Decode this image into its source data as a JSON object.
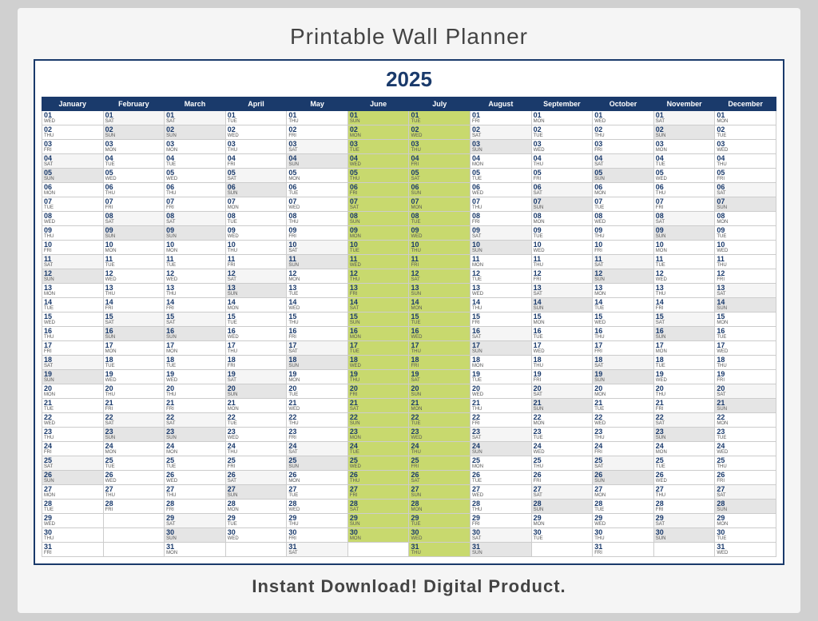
{
  "title": "Printable Wall Planner",
  "year": "2025",
  "footer": "Instant Download!  Digital Product.",
  "months": [
    {
      "name": "January",
      "abbr": "Jan"
    },
    {
      "name": "February",
      "abbr": "Feb"
    },
    {
      "name": "March",
      "abbr": "Mar"
    },
    {
      "name": "April",
      "abbr": "Apr"
    },
    {
      "name": "May",
      "abbr": "May"
    },
    {
      "name": "June",
      "abbr": "Jun"
    },
    {
      "name": "July",
      "abbr": "Jul"
    },
    {
      "name": "August",
      "abbr": "Aug"
    },
    {
      "name": "September",
      "abbr": "Sep"
    },
    {
      "name": "October",
      "abbr": "Oct"
    },
    {
      "name": "November",
      "abbr": "Nov"
    },
    {
      "name": "December",
      "abbr": "Dec"
    }
  ],
  "days_2025": {
    "Jan": [
      "WED",
      "THU",
      "FRI",
      "SAT",
      "SUN",
      "MON",
      "TUE",
      "WED",
      "THU",
      "FRI",
      "SAT",
      "SUN",
      "MON",
      "TUE",
      "WED",
      "THU",
      "FRI",
      "SAT",
      "SUN",
      "MON",
      "TUE",
      "WED",
      "THU",
      "FRI",
      "SAT",
      "SUN",
      "MON",
      "TUE",
      "WED",
      "THU",
      "FRI"
    ],
    "Feb": [
      "SAT",
      "SUN",
      "MON",
      "TUE",
      "WED",
      "THU",
      "FRI",
      "SAT",
      "SUN",
      "MON",
      "TUE",
      "WED",
      "THU",
      "FRI",
      "SAT",
      "SUN",
      "MON",
      "TUE",
      "WED",
      "THU",
      "FRI",
      "SAT",
      "SUN",
      "MON",
      "TUE",
      "WED",
      "THU",
      "FRI",
      "",
      "",
      ""
    ],
    "Mar": [
      "SAT",
      "SUN",
      "MON",
      "TUE",
      "WED",
      "THU",
      "FRI",
      "SAT",
      "SUN",
      "MON",
      "TUE",
      "WED",
      "THU",
      "FRI",
      "SAT",
      "SUN",
      "MON",
      "TUE",
      "WED",
      "THU",
      "FRI",
      "SAT",
      "SUN",
      "MON",
      "TUE",
      "WED",
      "THU",
      "FRI",
      "SAT",
      "SUN",
      "MON"
    ],
    "Apr": [
      "TUE",
      "WED",
      "THU",
      "FRI",
      "SAT",
      "SUN",
      "MON",
      "TUE",
      "WED",
      "THU",
      "FRI",
      "SAT",
      "SUN",
      "MON",
      "TUE",
      "WED",
      "THU",
      "FRI",
      "SAT",
      "SUN",
      "MON",
      "TUE",
      "WED",
      "THU",
      "FRI",
      "SAT",
      "SUN",
      "MON",
      "TUE",
      "WED",
      ""
    ],
    "May": [
      "THU",
      "FRI",
      "SAT",
      "SUN",
      "MON",
      "TUE",
      "WED",
      "THU",
      "FRI",
      "SAT",
      "SUN",
      "MON",
      "TUE",
      "WED",
      "THU",
      "FRI",
      "SAT",
      "SUN",
      "MON",
      "TUE",
      "WED",
      "THU",
      "FRI",
      "SAT",
      "SUN",
      "MON",
      "TUE",
      "WED",
      "THU",
      "FRI",
      "SAT"
    ],
    "Jun": [
      "SUN",
      "MON",
      "TUE",
      "WED",
      "THU",
      "FRI",
      "SAT",
      "SUN",
      "MON",
      "TUE",
      "WED",
      "THU",
      "FRI",
      "SAT",
      "SUN",
      "MON",
      "TUE",
      "WED",
      "THU",
      "FRI",
      "SAT",
      "SUN",
      "MON",
      "TUE",
      "WED",
      "THU",
      "FRI",
      "SAT",
      "SUN",
      "MON",
      ""
    ],
    "Jul": [
      "TUE",
      "WED",
      "THU",
      "FRI",
      "SAT",
      "SUN",
      "MON",
      "TUE",
      "WED",
      "THU",
      "FRI",
      "SAT",
      "SUN",
      "MON",
      "TUE",
      "WED",
      "THU",
      "FRI",
      "SAT",
      "SUN",
      "MON",
      "TUE",
      "WED",
      "THU",
      "FRI",
      "SAT",
      "SUN",
      "MON",
      "TUE",
      "WED",
      "THU"
    ],
    "Aug": [
      "FRI",
      "SAT",
      "SUN",
      "MON",
      "TUE",
      "WED",
      "THU",
      "FRI",
      "SAT",
      "SUN",
      "MON",
      "TUE",
      "WED",
      "THU",
      "FRI",
      "SAT",
      "SUN",
      "MON",
      "TUE",
      "WED",
      "THU",
      "FRI",
      "SAT",
      "SUN",
      "MON",
      "TUE",
      "WED",
      "THU",
      "FRI",
      "SAT",
      "SUN"
    ],
    "Sep": [
      "MON",
      "TUE",
      "WED",
      "THU",
      "FRI",
      "SAT",
      "SUN",
      "MON",
      "TUE",
      "WED",
      "THU",
      "FRI",
      "SAT",
      "SUN",
      "MON",
      "TUE",
      "WED",
      "THU",
      "FRI",
      "SAT",
      "SUN",
      "MON",
      "TUE",
      "WED",
      "THU",
      "FRI",
      "SAT",
      "SUN",
      "MON",
      "TUE",
      ""
    ],
    "Oct": [
      "WED",
      "THU",
      "FRI",
      "SAT",
      "SUN",
      "MON",
      "TUE",
      "WED",
      "THU",
      "FRI",
      "SAT",
      "SUN",
      "MON",
      "TUE",
      "WED",
      "THU",
      "FRI",
      "SAT",
      "SUN",
      "MON",
      "TUE",
      "WED",
      "THU",
      "FRI",
      "SAT",
      "SUN",
      "MON",
      "TUE",
      "WED",
      "THU",
      "FRI"
    ],
    "Nov": [
      "SAT",
      "SUN",
      "MON",
      "TUE",
      "WED",
      "THU",
      "FRI",
      "SAT",
      "SUN",
      "MON",
      "TUE",
      "WED",
      "THU",
      "FRI",
      "SAT",
      "SUN",
      "MON",
      "TUE",
      "WED",
      "THU",
      "FRI",
      "SAT",
      "SUN",
      "MON",
      "TUE",
      "WED",
      "THU",
      "FRI",
      "SAT",
      "SUN",
      ""
    ],
    "Dec": [
      "MON",
      "TUE",
      "WED",
      "THU",
      "FRI",
      "SAT",
      "SUN",
      "MON",
      "TUE",
      "WED",
      "THU",
      "FRI",
      "SAT",
      "SUN",
      "MON",
      "TUE",
      "WED",
      "THU",
      "FRI",
      "SAT",
      "SUN",
      "MON",
      "TUE",
      "WED",
      "THU",
      "FRI",
      "SAT",
      "SUN",
      "MON",
      "TUE",
      "WED"
    ]
  }
}
